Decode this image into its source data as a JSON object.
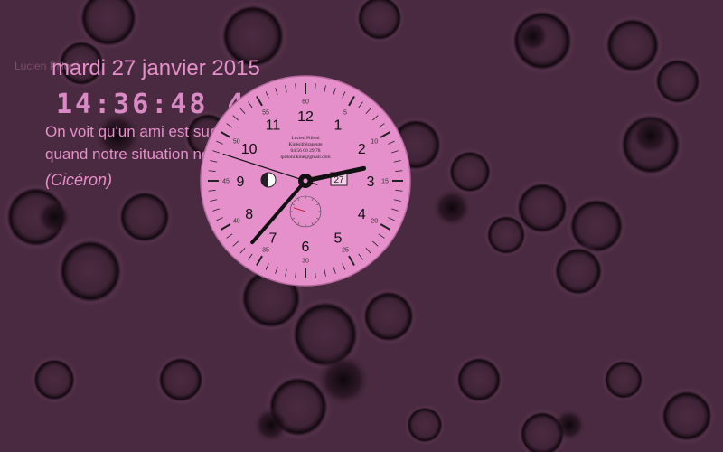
{
  "colors": {
    "background": "#4a2a40",
    "text": "#e58fcb",
    "clock_face": "#e58fcb",
    "hands": "#111111"
  },
  "watermark": "Lucien Pilloni",
  "date": "mardi 27 janvier 2015",
  "time": "14:36:48",
  "time_suffix": "44",
  "quote": {
    "line1": "On voit qu'un ami est sur",
    "line2": "quand notre situation ne l'est pas.",
    "author": "(Cicéron)"
  },
  "clock": {
    "hours": 14,
    "minutes": 36,
    "seconds": 48,
    "hour_numbers": [
      "12",
      "1",
      "2",
      "3",
      "4",
      "5",
      "6",
      "7",
      "8",
      "9",
      "10",
      "11"
    ],
    "minute_labels": [
      "60",
      "5",
      "10",
      "15",
      "20",
      "25",
      "30",
      "35",
      "40",
      "45",
      "50",
      "55"
    ],
    "day_of_month": "27",
    "card_lines": [
      "Lucien Pilloni",
      "Kinésithérapeute",
      "04 56 00 29 78",
      "lpilloni.kine@gmail.com"
    ],
    "moon_phase_icon": "half-moon-icon"
  }
}
